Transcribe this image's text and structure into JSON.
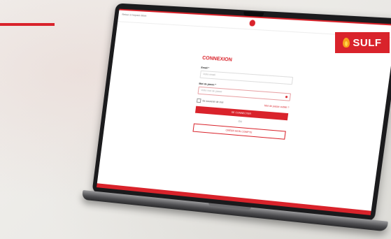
{
  "page": {
    "back_link": "Retour à l'espace élève",
    "brand": "SULF"
  },
  "form": {
    "title": "CONNEXION",
    "email_label": "Email *",
    "email_placeholder": "Votre email",
    "password_label": "Mot de passe *",
    "password_placeholder": "Votre mot de passe",
    "remember_label": "Se souvenir de moi",
    "forgot_label": "Mot de passe oublié ?",
    "login_button": "SE CONNECTER",
    "or_label": "OU",
    "create_button": "CRÉER MON COMPTE"
  },
  "colors": {
    "accent": "#d9232b",
    "flame": "#f7a21b"
  }
}
